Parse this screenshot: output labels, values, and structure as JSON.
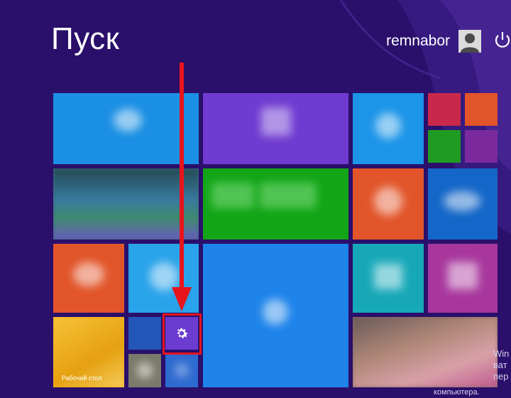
{
  "start": {
    "title": "Пуск",
    "username": "remnabor"
  },
  "tiles": {
    "desktop_label": "Рабочий стол"
  },
  "watermark": {
    "line1": "Win",
    "line2": "ват",
    "line3": "пер",
    "bottom": "компьютера."
  },
  "colors": {
    "background": "#2a0f6b",
    "highlight": "#e8141c",
    "arrow": "#e8141c"
  },
  "icons": {
    "settings": "gear-icon",
    "power": "power-icon",
    "avatar": "user-avatar-icon"
  }
}
